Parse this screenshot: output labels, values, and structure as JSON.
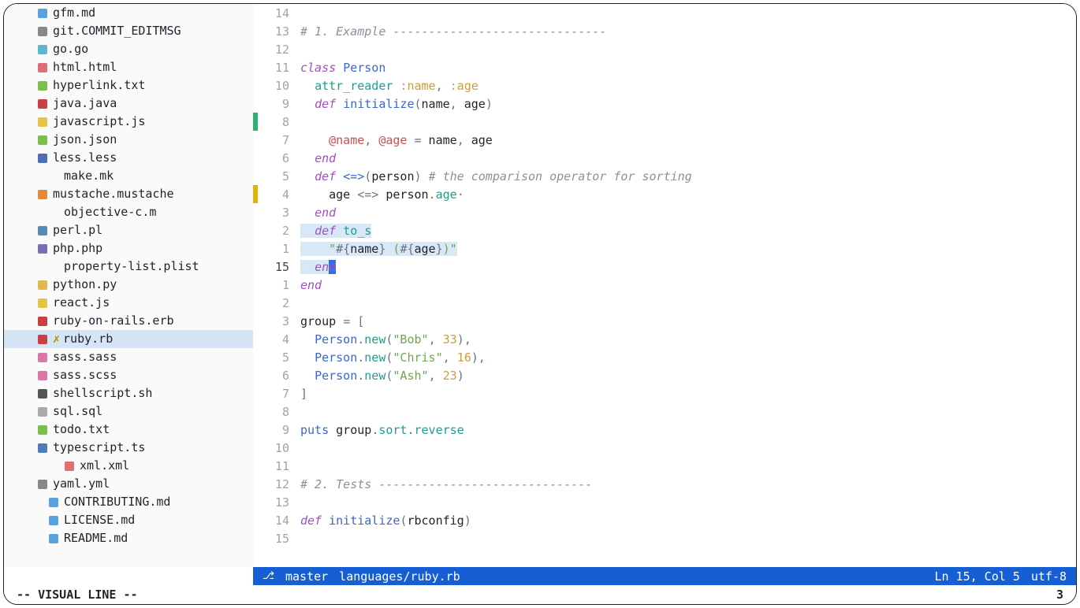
{
  "sidebar": {
    "files": [
      {
        "icon": "md",
        "color": "#5aa1e0",
        "name": "gfm.md",
        "indent": true
      },
      {
        "icon": "git",
        "color": "#888",
        "name": "git.COMMIT_EDITMSG",
        "indent": true
      },
      {
        "icon": "go",
        "color": "#5fb4cf",
        "name": "go.go",
        "indent": true
      },
      {
        "icon": "html",
        "color": "#e06c75",
        "name": "html.html",
        "indent": true
      },
      {
        "icon": "txt",
        "color": "#7cbf4f",
        "name": "hyperlink.txt",
        "indent": true
      },
      {
        "icon": "java",
        "color": "#cc3e44",
        "name": "java.java",
        "indent": true
      },
      {
        "icon": "js",
        "color": "#e6c446",
        "name": "javascript.js",
        "indent": true
      },
      {
        "icon": "json",
        "color": "#7cbf4f",
        "name": "json.json",
        "indent": true
      },
      {
        "icon": "less",
        "color": "#4f6db3",
        "name": "less.less",
        "indent": true
      },
      {
        "icon": "",
        "color": "",
        "name": "make.mk",
        "indent": false
      },
      {
        "icon": "ms",
        "color": "#e08a3a",
        "name": "mustache.mustache",
        "indent": true
      },
      {
        "icon": "",
        "color": "",
        "name": "objective-c.m",
        "indent": false
      },
      {
        "icon": "pl",
        "color": "#5a8ab3",
        "name": "perl.pl",
        "indent": true
      },
      {
        "icon": "php",
        "color": "#7a6fb0",
        "name": "php.php",
        "indent": true
      },
      {
        "icon": "",
        "color": "",
        "name": "property-list.plist",
        "indent": false
      },
      {
        "icon": "py",
        "color": "#e0b850",
        "name": "python.py",
        "indent": true
      },
      {
        "icon": "js",
        "color": "#e6c446",
        "name": "react.js",
        "indent": true
      },
      {
        "icon": "erb",
        "color": "#cc3e44",
        "name": "ruby-on-rails.erb",
        "indent": true
      },
      {
        "icon": "rb",
        "color": "#cc3e44",
        "name": "ruby.rb",
        "indent": true,
        "active": true,
        "mod": "✗"
      },
      {
        "icon": "sass",
        "color": "#d977a6",
        "name": "sass.sass",
        "indent": true
      },
      {
        "icon": "sass",
        "color": "#d977a6",
        "name": "sass.scss",
        "indent": true
      },
      {
        "icon": "sh",
        "color": "#555",
        "name": "shellscript.sh",
        "indent": true
      },
      {
        "icon": "sql",
        "color": "#aaa",
        "name": "sql.sql",
        "indent": true
      },
      {
        "icon": "txt",
        "color": "#7cbf4f",
        "name": "todo.txt",
        "indent": true
      },
      {
        "icon": "ts",
        "color": "#4f7db3",
        "name": "typescript.ts",
        "indent": true
      },
      {
        "icon": "xml",
        "color": "#e06c75",
        "name": "xml.xml",
        "indent": true,
        "extraIndent": true
      },
      {
        "icon": "yml",
        "color": "#888",
        "name": "yaml.yml",
        "indent": true
      },
      {
        "icon": "md",
        "color": "#5aa1e0",
        "name": "CONTRIBUTING.md",
        "indent": false,
        "iconOverride": true
      },
      {
        "icon": "md",
        "color": "#5aa1e0",
        "name": "LICENSE.md",
        "indent": false,
        "iconOverride": true
      },
      {
        "icon": "md",
        "color": "#5aa1e0",
        "name": "README.md",
        "indent": false,
        "iconOverride": true
      }
    ]
  },
  "editor": {
    "lines": [
      {
        "no": "14",
        "html": ""
      },
      {
        "no": "13",
        "html": "<span class='c'># 1. Example ------------------------------</span>"
      },
      {
        "no": "12",
        "html": ""
      },
      {
        "no": "11",
        "html": "<span class='kw'>class</span> <span class='id'>Person</span>"
      },
      {
        "no": "10",
        "html": "  <span class='meth'>attr_reader</span> <span class='sym'>:name</span><span class='op'>,</span> <span class='sym'>:age</span>"
      },
      {
        "no": "9",
        "html": "  <span class='kw'>def</span> <span class='fn'>initialize</span><span class='op'>(</span>name<span class='op'>,</span> age<span class='op'>)</span>"
      },
      {
        "no": "8",
        "html": "",
        "sign": "green"
      },
      {
        "no": "7",
        "html": "    <span class='ivar'>@name</span><span class='op'>,</span> <span class='ivar'>@age</span> <span class='op'>=</span> name<span class='op'>,</span> age"
      },
      {
        "no": "6",
        "html": "  <span class='kw'>end</span>"
      },
      {
        "no": "5",
        "html": "  <span class='kw'>def</span> <span class='fn'>&lt;=&gt;</span><span class='op'>(</span>person<span class='op'>)</span> <span class='c'># the comparison operator for sorting</span>"
      },
      {
        "no": "4",
        "html": "    age <span class='op'>&lt;=&gt;</span> person<span class='op'>.</span><span class='call'>age</span><span class='op'>·</span>",
        "sign": "yellow"
      },
      {
        "no": "3",
        "html": "  <span class='kw'>end</span>"
      },
      {
        "no": "2",
        "html": "<span class='hl-sel'>  <span class='kw'>def</span> <span class='meth'>to_s</span></span>"
      },
      {
        "no": "1",
        "html": "<span class='hl-sel'>    <span class='str'>\"</span><span class='op'>#{</span>name<span class='op'>}</span><span class='str'> (</span><span class='op'>#{</span>age<span class='op'>}</span><span class='str'>)\"</span></span>"
      },
      {
        "no": "15",
        "current": true,
        "html": "<span class='hl-sel'>  <span class='kw'>en</span></span><span class='hl-cursor kw'>d</span>"
      },
      {
        "no": "1",
        "html": "<span class='kw'>end</span>"
      },
      {
        "no": "2",
        "html": ""
      },
      {
        "no": "3",
        "html": "group <span class='op'>=</span> <span class='op'>[</span>"
      },
      {
        "no": "4",
        "html": "  <span class='id'>Person</span><span class='op'>.</span><span class='call'>new</span><span class='op'>(</span><span class='str'>\"Bob\"</span><span class='op'>,</span> <span class='num'>33</span><span class='op'>),</span>"
      },
      {
        "no": "5",
        "html": "  <span class='id'>Person</span><span class='op'>.</span><span class='call'>new</span><span class='op'>(</span><span class='str'>\"Chris\"</span><span class='op'>,</span> <span class='num'>16</span><span class='op'>),</span>"
      },
      {
        "no": "6",
        "html": "  <span class='id'>Person</span><span class='op'>.</span><span class='call'>new</span><span class='op'>(</span><span class='str'>\"Ash\"</span><span class='op'>,</span> <span class='num'>23</span><span class='op'>)</span>"
      },
      {
        "no": "7",
        "html": "<span class='op'>]</span>"
      },
      {
        "no": "8",
        "html": ""
      },
      {
        "no": "9",
        "html": "<span class='id'>puts</span> group<span class='op'>.</span><span class='call'>sort</span><span class='op'>.</span><span class='call'>reverse</span>"
      },
      {
        "no": "10",
        "html": ""
      },
      {
        "no": "11",
        "html": ""
      },
      {
        "no": "12",
        "html": "<span class='c'># 2. Tests ------------------------------</span>"
      },
      {
        "no": "13",
        "html": ""
      },
      {
        "no": "14",
        "html": "<span class='kw'>def</span> <span class='fn'>initialize</span><span class='op'>(</span>rbconfig<span class='op'>)</span>"
      },
      {
        "no": "15",
        "html": ""
      }
    ]
  },
  "status": {
    "branch": "master",
    "path": "languages/ruby.rb",
    "position": "Ln 15, Col 5",
    "encoding": "utf-8"
  },
  "mode": {
    "label": "-- VISUAL LINE --",
    "count": "3"
  }
}
